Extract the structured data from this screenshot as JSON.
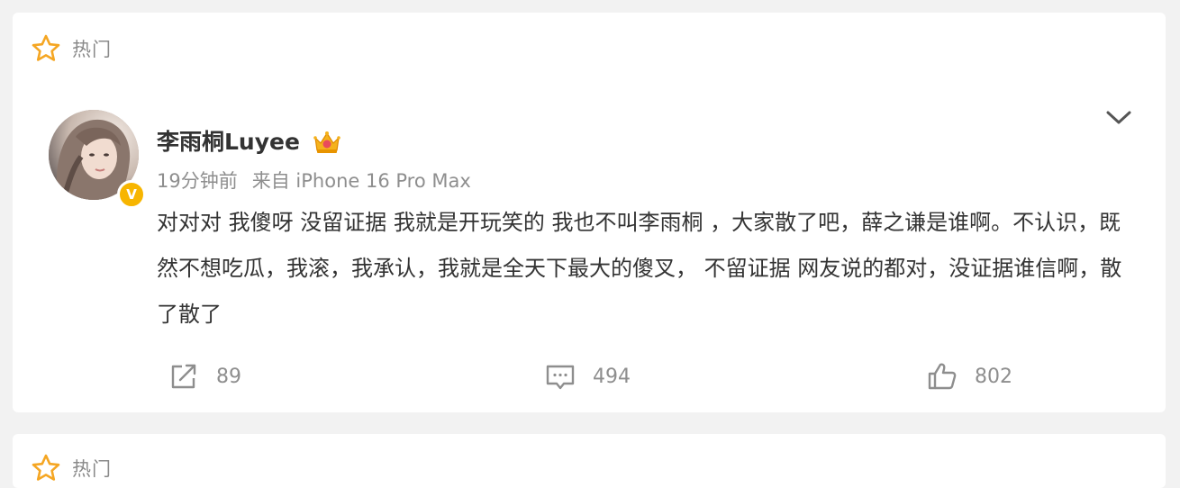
{
  "feed": {
    "section_label": "热门"
  },
  "post": {
    "author": {
      "name": "李雨桐Luyee",
      "verified_mark": "V"
    },
    "meta": {
      "time": "19分钟前",
      "source": "来自 iPhone 16 Pro Max"
    },
    "content": "对对对 我傻呀 没留证据 我就是开玩笑的 我也不叫李雨桐 ，大家散了吧，薛之谦是谁啊。不认识，既然不想吃瓜，我滚，我承认，我就是全天下最大的傻叉， 不留证据 网友说的都对，没证据谁信啊，散了散了",
    "stats": {
      "shares": "89",
      "comments": "494",
      "likes": "802"
    }
  },
  "next_card": {
    "section_label": "热门"
  },
  "colors": {
    "star": "#f5a623",
    "verified": "#f7b500",
    "text": "#333333",
    "muted": "#8e8e8e"
  },
  "icons": [
    "star-icon",
    "crown-icon",
    "chevron-down-icon",
    "share-icon",
    "comment-icon",
    "like-icon"
  ]
}
